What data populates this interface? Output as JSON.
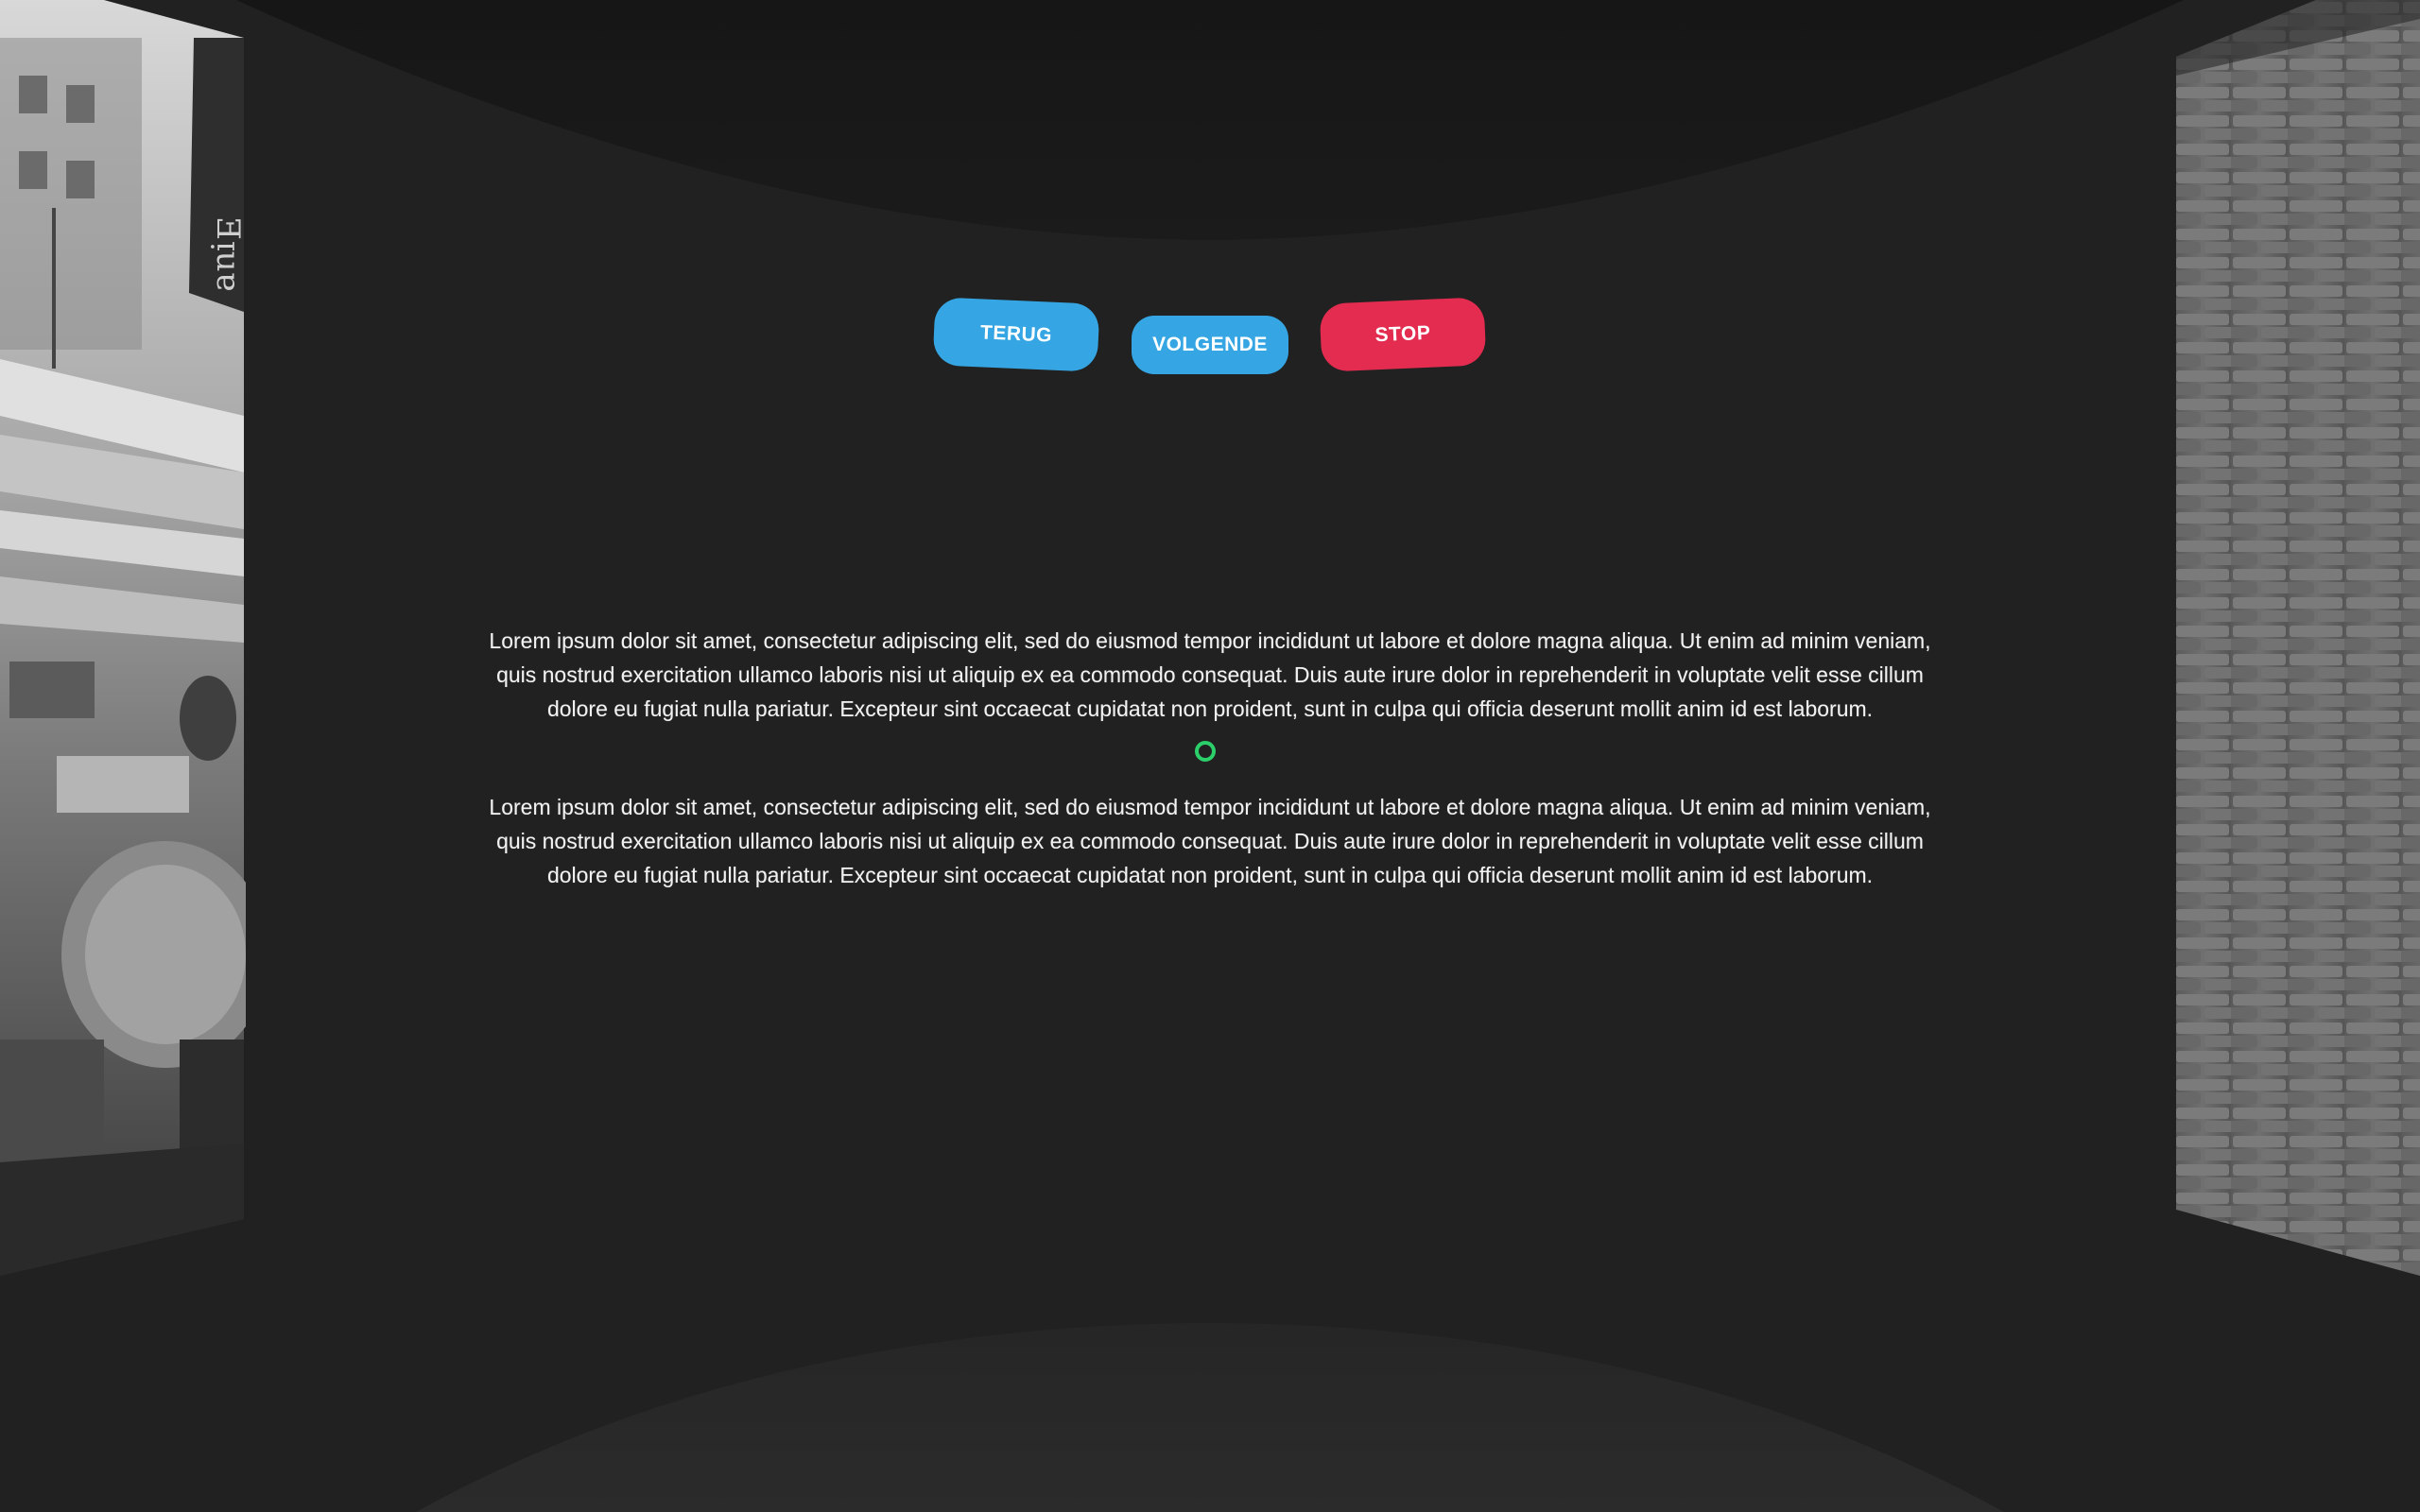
{
  "buttons": {
    "back_label": "TERUG",
    "next_label": "VOLGENDE",
    "stop_label": "STOP"
  },
  "content": {
    "paragraph_1": "Lorem ipsum dolor sit amet, consectetur adipiscing elit, sed do eiusmod tempor incididunt ut labore et dolore magna aliqua. Ut enim ad minim veniam, quis nostrud exercitation ullamco laboris nisi ut aliquip ex ea commodo consequat. Duis aute irure dolor in reprehenderit in voluptate velit esse cillum dolore eu fugiat nulla pariatur. Excepteur sint occaecat cupidatat non proident, sunt in culpa qui officia deserunt mollit anim id est laborum.",
    "paragraph_2": "Lorem ipsum dolor sit amet, consectetur adipiscing elit, sed do eiusmod tempor incididunt ut labore et dolore magna aliqua. Ut enim ad minim veniam, quis nostrud exercitation ullamco laboris nisi ut aliquip ex ea commodo consequat. Duis aute irure dolor in reprehenderit in voluptate velit esse cillum dolore eu fugiat nulla pariatur. Excepteur sint occaecat cupidatat non proident, sunt in culpa qui officia deserunt mollit anim id est laborum."
  },
  "colors": {
    "background": "#212121",
    "button_primary": "#35a6e3",
    "button_stop": "#e32c4f",
    "reticle": "#2bd06b",
    "text": "#f2f2f2"
  },
  "icons": {
    "reticle": "gaze-reticle-icon"
  }
}
